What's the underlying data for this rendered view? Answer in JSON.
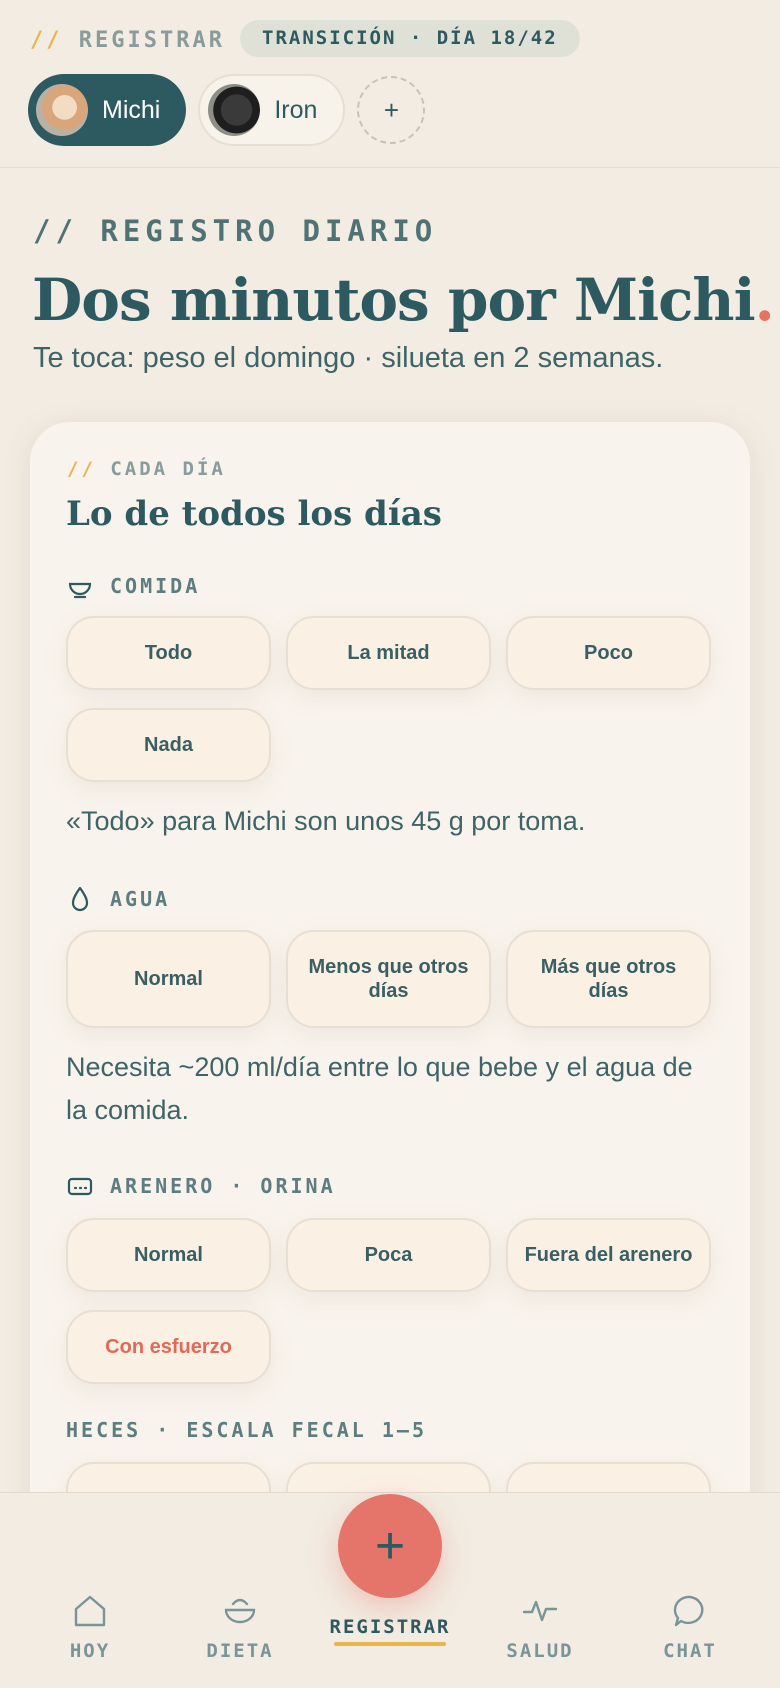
{
  "header": {
    "crumb_slash": "//",
    "crumb": "REGISTRAR",
    "phase_badge": "TRANSICIÓN · DÍA 18/42",
    "pets": [
      {
        "name": "Michi",
        "active": true
      },
      {
        "name": "Iron",
        "active": false
      }
    ],
    "add_pet": "+"
  },
  "intro": {
    "eyebrow": "// REGISTRO DIARIO",
    "title": "Dos minutos por Michi",
    "title_dot": ".",
    "subtitle": "Te toca: peso el domingo · silueta en 2 semanas."
  },
  "card": {
    "eyebrow_slash": "//",
    "eyebrow": "CADA DÍA",
    "title": "Lo de todos los días",
    "comida": {
      "label": "COMIDA",
      "icon": "bowl-icon",
      "options": [
        "Todo",
        "La mitad",
        "Poco",
        "Nada"
      ],
      "note": "«Todo» para Michi son unos 45 g por toma."
    },
    "agua": {
      "label": "AGUA",
      "icon": "water-drop-icon",
      "options": [
        "Normal",
        "Menos que otros días",
        "Más que otros días"
      ],
      "note": "Necesita ~200 ml/día entre lo que bebe y el agua de la comida."
    },
    "arenero": {
      "label": "ARENERO · ORINA",
      "icon": "litter-box-icon",
      "options": [
        "Normal",
        "Poca",
        "Fuera del arenero",
        "Con esfuerzo"
      ]
    },
    "heces": {
      "label": "HECES · ESCALA FECAL 1–5"
    }
  },
  "nav": {
    "fab": "+",
    "items": [
      {
        "label": "HOY",
        "icon": "home-icon"
      },
      {
        "label": "DIETA",
        "icon": "bowl-icon"
      },
      {
        "label": "REGISTRAR",
        "icon": "plus-icon"
      },
      {
        "label": "SALUD",
        "icon": "pulse-icon"
      },
      {
        "label": "CHAT",
        "icon": "chat-bubble-icon"
      }
    ]
  },
  "colors": {
    "background": "#f2ece2",
    "primary": "#2c5a60",
    "accent": "#e5746a",
    "highlight": "#e8b64a"
  }
}
